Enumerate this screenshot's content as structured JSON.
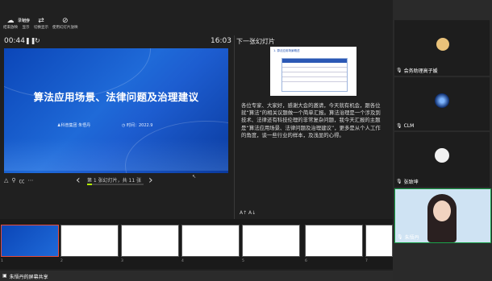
{
  "toolbar": {
    "items": [
      {
        "icon": "cloud-icon",
        "label": "结束放映"
      },
      {
        "icon": "monitor-icon",
        "label": "显示"
      },
      {
        "icon": "swap-icon",
        "label": "切换显示"
      },
      {
        "icon": "hide-icon",
        "label": "使用幻灯片放映"
      }
    ],
    "top_label": "录制中"
  },
  "presenter": {
    "elapsed": "00:44",
    "clock": "16:03",
    "next_label": "下一张幻灯片",
    "slide_title": "算法应用场景、法律问题及治理建议",
    "slide_author": "♟科普集团 朱悟丹",
    "slide_date": "◷ 时间：2022.9",
    "slide_counter": "第 1 张幻灯片，共 11 张",
    "notes": "各位专家、大家好，感谢大会的邀请，今天就有机会，跟各位就“算法”的相关议题做一个简单汇报。算法治理是一个涉及到技术、法律还有科技伦理的非常复杂问题，我今天汇报的主题是“算法应用场景、法律问题及治理建议”，更多是从个人工作的角度，谈一些行业的样本，及浅显的心得。",
    "next_slide_caption": "1. 算法应用场景概述"
  },
  "participants": [
    {
      "name": "会务助理高子媛"
    },
    {
      "name": "CLM"
    },
    {
      "name": "张致坤"
    },
    {
      "name": "朱悟丹"
    }
  ],
  "thumbnails": [
    "1",
    "2",
    "3",
    "4",
    "5",
    "6",
    "7"
  ],
  "footer": {
    "label": "朱悟丹的屏幕共享"
  },
  "colors": {
    "slide_blue": "#1d5dd0",
    "active_border": "#1aa34a",
    "progress": "#b4ff00"
  }
}
